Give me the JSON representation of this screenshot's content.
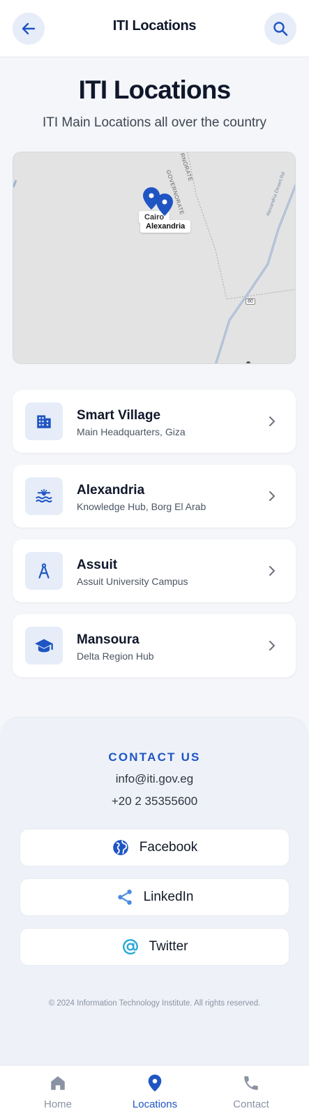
{
  "app": {
    "title": "ITI Locations",
    "accent": "#1f55c3"
  },
  "header": {
    "back_icon": "arrow-left-icon",
    "search_icon": "search-icon",
    "title": "ITI Locations"
  },
  "hero": {
    "title": "ITI Locations",
    "subtitle": "ITI Main Locations all over the country"
  },
  "map": {
    "labels": {
      "cairo": "Cairo",
      "alexandria": "Alexandria",
      "region1": "GOVERNORATE",
      "region2": "RNORATE",
      "road_sign": "80",
      "road_name": "Alexandria Desert Rd"
    },
    "pins": [
      "Cairo",
      "Alexandria"
    ]
  },
  "locations": [
    {
      "name": "Smart Village",
      "desc": "Main Headquarters, Giza",
      "icon": "building-icon"
    },
    {
      "name": "Alexandria",
      "desc": "Knowledge Hub, Borg El Arab",
      "icon": "waves-icon"
    },
    {
      "name": "Assuit",
      "desc": "Assuit University Campus",
      "icon": "compass-icon"
    },
    {
      "name": "Mansoura",
      "desc": "Delta Region Hub",
      "icon": "graduation-cap-icon"
    }
  ],
  "contact": {
    "heading": "CONTACT US",
    "email": "info@iti.gov.eg",
    "phone": "+20 2 35355600",
    "socials": [
      {
        "label": "Facebook",
        "icon": "globe-icon"
      },
      {
        "label": "LinkedIn",
        "icon": "share-icon"
      },
      {
        "label": "Twitter",
        "icon": "at-sign-icon"
      }
    ],
    "copyright": "© 2024 Information Technology Institute. All rights reserved."
  },
  "nav": {
    "items": [
      {
        "label": "Home",
        "icon": "home-icon"
      },
      {
        "label": "Locations",
        "icon": "location-pin-icon"
      },
      {
        "label": "Contact",
        "icon": "phone-icon"
      }
    ],
    "active": "Locations"
  }
}
